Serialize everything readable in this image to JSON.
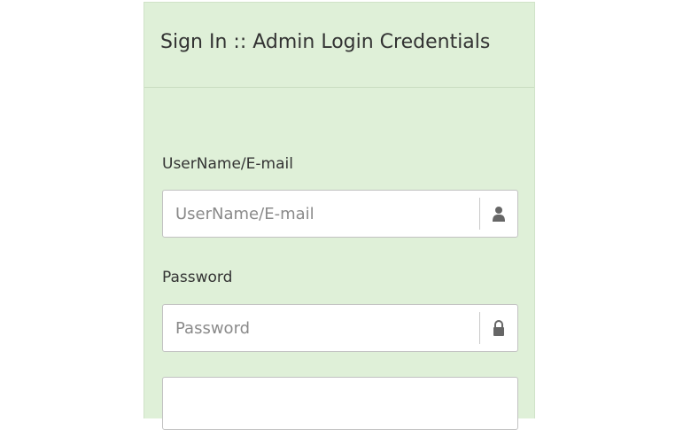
{
  "panel": {
    "title": "Sign In :: Admin Login Credentials"
  },
  "username": {
    "label": "UserName/E-mail",
    "placeholder": "UserName/E-mail",
    "value": "",
    "icon": "user-icon"
  },
  "password": {
    "label": "Password",
    "placeholder": "Password",
    "value": "",
    "icon": "lock-icon"
  },
  "colors": {
    "panel_background": "#dff0d8",
    "panel_border": "#c9dcc0",
    "text": "#333333",
    "icon": "#666666"
  }
}
